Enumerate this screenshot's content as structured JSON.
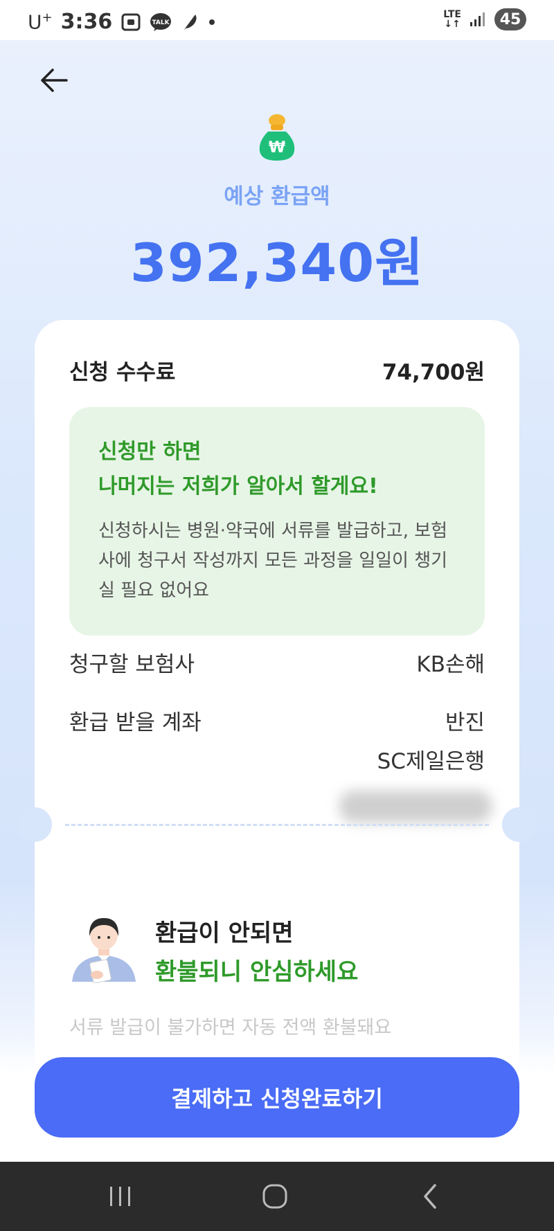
{
  "status_bar": {
    "carrier": "U",
    "carrier_sup": "+",
    "time": "3:36",
    "network": "LTE",
    "battery": "45"
  },
  "header": {
    "refund_label": "예상 환급액",
    "refund_amount": "392,340원"
  },
  "fee": {
    "label": "신청 수수료",
    "value": "74,700원"
  },
  "info_box": {
    "title_line1": "신청만 하면",
    "title_line2": "나머지는 저희가 알아서 할게요!",
    "body": "신청하시는 병원·약국에 서류를 발급하고, 보험사에 청구서 작성까지 모든 과정을 일일이 챙기실 필요 없어요"
  },
  "insurer": {
    "label": "청구할 보험사",
    "value": "KB손해"
  },
  "account": {
    "label": "환급 받을 계좌",
    "holder": "반진",
    "bank": "SC제일은행"
  },
  "guarantee": {
    "title": "환급이 안되면",
    "subtitle": "환불되니 안심하세요",
    "description": "서류 발급이 불가하면 자동 전액 환불돼요"
  },
  "cta": {
    "label": "결제하고 신청완료하기"
  },
  "colors": {
    "primary": "#4a6cf6",
    "amount": "#4472f1",
    "green": "#2f9a2a",
    "info_bg": "#e7f5e6"
  }
}
